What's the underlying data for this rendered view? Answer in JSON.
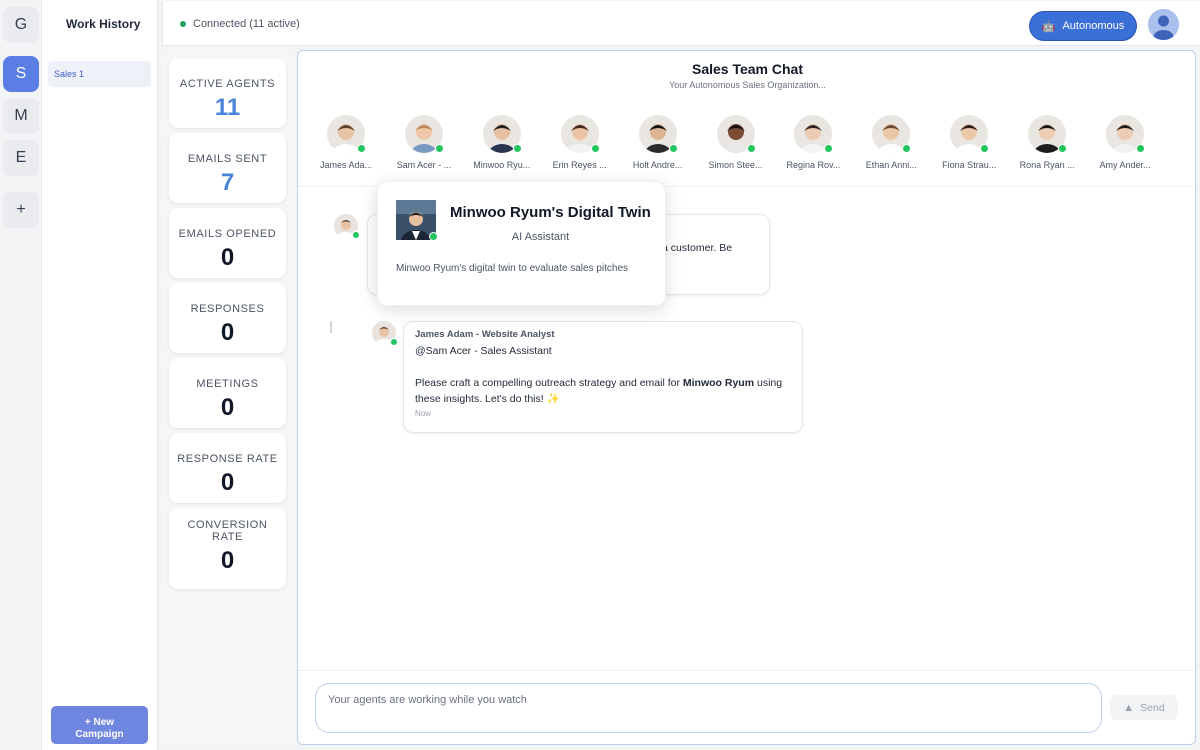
{
  "rail": {
    "items": [
      {
        "label": "G",
        "active": false
      },
      {
        "label": "S",
        "active": true
      },
      {
        "label": "M",
        "active": false
      },
      {
        "label": "E",
        "active": false
      },
      {
        "label": "+",
        "active": false
      }
    ]
  },
  "history": {
    "title": "Work History",
    "items": [
      "Sales 1"
    ],
    "new_campaign_line1": "+ New",
    "new_campaign_line2": "Campaign"
  },
  "topbar": {
    "status": "Connected (11 active)",
    "autonomous_label": "Autonomous",
    "robot_icon": "robot-icon"
  },
  "stats": [
    {
      "label": "ACTIVE AGENTS",
      "value": "11",
      "accent": true
    },
    {
      "label": "EMAILS SENT",
      "value": "7",
      "accent": true
    },
    {
      "label": "EMAILS OPENED",
      "value": "0",
      "accent": false
    },
    {
      "label": "RESPONSES",
      "value": "0",
      "accent": false
    },
    {
      "label": "MEETINGS",
      "value": "0",
      "accent": false
    },
    {
      "label": "RESPONSE RATE",
      "value": "0",
      "accent": false
    },
    {
      "label": "CONVERSION RATE",
      "value": "0",
      "accent": false
    }
  ],
  "chat": {
    "title": "Sales Team Chat",
    "subtitle": "Your Autonomous Sales Organization...",
    "agents": [
      {
        "name": "James Ada...",
        "skin": "#e8c3a4",
        "hair": "#5b4030",
        "shirt": "#ffffff"
      },
      {
        "name": "Sam Acer - ...",
        "skin": "#eec8a8",
        "hair": "#b88a55",
        "shirt": "#7a9bbf"
      },
      {
        "name": "Minwoo Ryu...",
        "skin": "#e6c0a0",
        "hair": "#1f1f22",
        "shirt": "#2a3550"
      },
      {
        "name": "Erin Reyes ...",
        "skin": "#eec4a6",
        "hair": "#3e2a20",
        "shirt": "#f3f3f3"
      },
      {
        "name": "Holt Andre...",
        "skin": "#dcb393",
        "hair": "#141414",
        "shirt": "#2b2b2b"
      },
      {
        "name": "Simon Stee...",
        "skin": "#7a4d33",
        "hair": "#1a1210",
        "shirt": "#e8e8e8"
      },
      {
        "name": "Regina Rov...",
        "skin": "#eccbb0",
        "hair": "#2a2220",
        "shirt": "#f4f4f4"
      },
      {
        "name": "Ethan Anni...",
        "skin": "#ebc7a8",
        "hair": "#6a4a32",
        "shirt": "#ffffff"
      },
      {
        "name": "Fiona Strau...",
        "skin": "#ecc8aa",
        "hair": "#2e211b",
        "shirt": "#ffffff"
      },
      {
        "name": "Rona Ryan ...",
        "skin": "#edcdb4",
        "hair": "#181616",
        "shirt": "#1d1d1d"
      },
      {
        "name": "Amy Ander...",
        "skin": "#eccdb3",
        "hair": "#1e1b19",
        "shirt": "#f2f2f2"
      }
    ],
    "messages": [
      {
        "text_line1": "a customer. Be"
      },
      {
        "author": "James Adam - Website Analyst",
        "mention": "@Sam Acer - Sales Assistant",
        "text_pre": "Please craft a compelling outreach strategy and email for ",
        "text_bold": "Minwoo Ryum",
        "text_post": " using",
        "text_line2": "these insights. Let's do this! ✨",
        "time": "Now"
      }
    ],
    "tooltip": {
      "name": "Minwoo Ryum's Digital Twin",
      "role": "AI Assistant",
      "description": "Minwoo Ryum's digital twin to evaluate sales pitches"
    },
    "input_placeholder": "Your agents are working while you watch",
    "send_label": "Send"
  },
  "colors": {
    "accent": "#3b6fd8",
    "rail_active": "#5b7ee5",
    "online": "#22c55e",
    "stat_accent": "#4a84d8"
  }
}
